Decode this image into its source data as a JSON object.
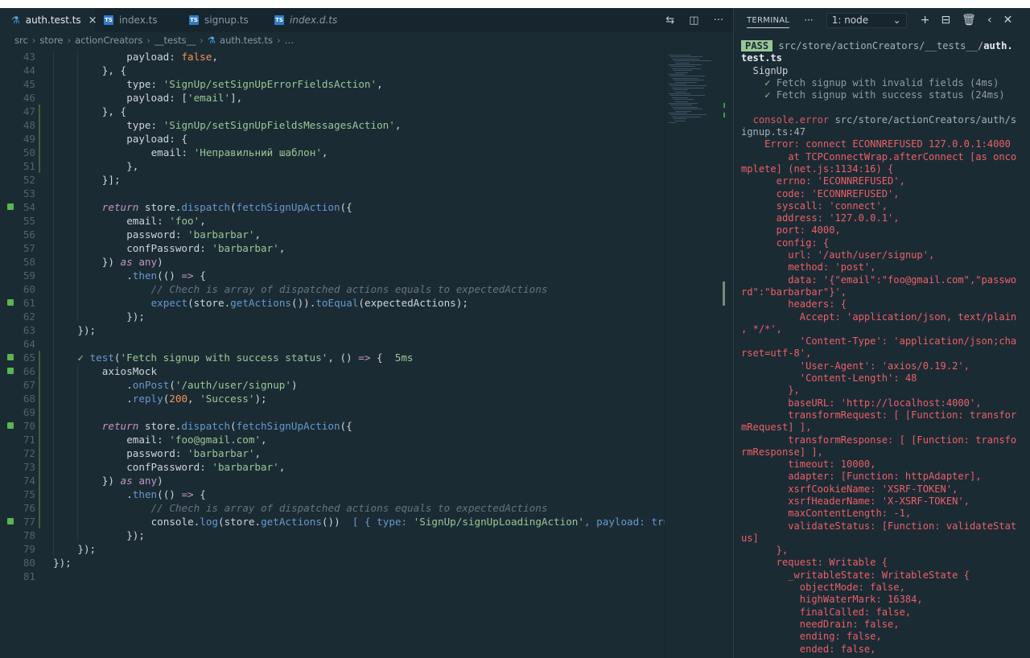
{
  "tabs": [
    {
      "label": "auth.test.ts",
      "active": true,
      "close": "×"
    },
    {
      "label": "index.ts",
      "active": false
    },
    {
      "label": "signup.ts",
      "active": false
    },
    {
      "label": "index.d.ts",
      "active": false
    }
  ],
  "breadcrumb": [
    "src",
    "store",
    "actionCreators",
    "__tests__",
    "auth.test.ts",
    "…"
  ],
  "code_lines": [
    {
      "n": "43",
      "indent": 12,
      "html": "<span class='pr'>payload</span>: <span class='b'>false</span>,"
    },
    {
      "n": "44",
      "indent": 8,
      "html": "}, {"
    },
    {
      "n": "45",
      "indent": 12,
      "html": "<span class='pr'>type</span>: <span class='s'>'SignUp/setSignUpErrorFieldsAction'</span>,"
    },
    {
      "n": "46",
      "indent": 12,
      "html": "<span class='pr'>payload</span>: [<span class='s'>'email'</span>],"
    },
    {
      "n": "47",
      "indent": 8,
      "html": "}, {"
    },
    {
      "n": "48",
      "indent": 12,
      "html": "<span class='pr'>type</span>: <span class='s'>'SignUp/setSignUpFieldsMessagesAction'</span>,"
    },
    {
      "n": "49",
      "indent": 12,
      "html": "<span class='pr'>payload</span>: {"
    },
    {
      "n": "50",
      "indent": 16,
      "html": "<span class='pr'>email</span>: <span class='s'>'Неправильний шаблон'</span>,"
    },
    {
      "n": "51",
      "indent": 12,
      "html": "},"
    },
    {
      "n": "52",
      "indent": 8,
      "html": "}];"
    },
    {
      "n": "53",
      "indent": 0,
      "html": ""
    },
    {
      "n": "54",
      "indent": 8,
      "html": "<span class='k'>return</span> store.<span class='f'>dispatch</span>(<span class='f'>fetchSignUpAction</span>({"
    },
    {
      "n": "55",
      "indent": 12,
      "html": "<span class='pr'>email</span>: <span class='s'>'foo'</span>,"
    },
    {
      "n": "56",
      "indent": 12,
      "html": "<span class='pr'>password</span>: <span class='s'>'barbarbar'</span>,"
    },
    {
      "n": "57",
      "indent": 12,
      "html": "<span class='pr'>confPassword</span>: <span class='s'>'barbarbar'</span>,"
    },
    {
      "n": "58",
      "indent": 8,
      "html": "}) <span class='k'>as</span> <span class='kw'>any</span>)"
    },
    {
      "n": "59",
      "indent": 12,
      "html": ".<span class='f'>then</span>(() <span class='kw'>=></span> {"
    },
    {
      "n": "60",
      "indent": 16,
      "html": "<span class='c'>// Chech is array of dispatched actions equals to expectedActions</span>"
    },
    {
      "n": "61",
      "indent": 16,
      "html": "<span class='f'>expect</span>(store.<span class='f'>getActions</span>()).<span class='f'>toEqual</span>(expectedActions);"
    },
    {
      "n": "62",
      "indent": 12,
      "html": "});"
    },
    {
      "n": "63",
      "indent": 4,
      "html": "});"
    },
    {
      "n": "64",
      "indent": 0,
      "html": ""
    },
    {
      "n": "65",
      "indent": 4,
      "html": "<span class='ok'>✓</span> <span class='f'>test</span>(<span class='s'>'Fetch signup with success status'</span>, () <span class='kw'>=></span> {  <span class='ok'>5ms</span>"
    },
    {
      "n": "66",
      "indent": 8,
      "html": "axiosMock"
    },
    {
      "n": "67",
      "indent": 12,
      "html": ".<span class='f'>onPost</span>(<span class='s'>'/auth/user/signup'</span>)"
    },
    {
      "n": "68",
      "indent": 12,
      "html": ".<span class='f'>reply</span>(<span class='b'>200</span>, <span class='s'>'Success'</span>);"
    },
    {
      "n": "69",
      "indent": 0,
      "html": ""
    },
    {
      "n": "70",
      "indent": 8,
      "html": "<span class='k'>return</span> store.<span class='f'>dispatch</span>(<span class='f'>fetchSignUpAction</span>({"
    },
    {
      "n": "71",
      "indent": 12,
      "html": "<span class='pr'>email</span>: <span class='s'>'foo@gmail.com'</span>,"
    },
    {
      "n": "72",
      "indent": 12,
      "html": "<span class='pr'>password</span>: <span class='s'>'barbarbar'</span>,"
    },
    {
      "n": "73",
      "indent": 12,
      "html": "<span class='pr'>confPassword</span>: <span class='s'>'barbarbar'</span>,"
    },
    {
      "n": "74",
      "indent": 8,
      "html": "}) <span class='k'>as</span> <span class='kw'>any</span>)"
    },
    {
      "n": "75",
      "indent": 12,
      "html": ".<span class='f'>then</span>(() <span class='kw'>=></span> {"
    },
    {
      "n": "76",
      "indent": 16,
      "html": "<span class='c'>// Chech is array of dispatched actions equals to expectedActions</span>"
    },
    {
      "n": "77",
      "indent": 16,
      "html": "console.<span class='f'>log</span>(store.<span class='f'>getActions</span>())  <span class='inl'>[ { type: </span><span class='s'>'SignUp/signUpLoadingAction'</span><span class='inl'>, payload: true</span>"
    },
    {
      "n": "78",
      "indent": 12,
      "html": "});"
    },
    {
      "n": "79",
      "indent": 4,
      "html": "});"
    },
    {
      "n": "80",
      "indent": 0,
      "html": "});"
    },
    {
      "n": "81",
      "indent": 0,
      "html": ""
    }
  ],
  "gutter_marks": [
    "54",
    "61",
    "65",
    "66",
    "70",
    "77"
  ],
  "terminal": {
    "title": "TERMINAL",
    "more": "···",
    "select": "1: node",
    "lines": [
      "<span class='pass'>PASS</span> <span class='dim'>src/store/actionCreators/__tests__/</span><span class='white'>auth.</span>",
      "<span class='white'>test.ts</span>",
      "  SignUp",
      "    <span class='ok'>✓</span> <span class='gray'>Fetch signup with invalid fields (4ms)</span>",
      "    <span class='ok'>✓</span> <span class='gray'>Fetch signup with success status (24ms)</span>",
      "",
      "  <span class='redd'>console.error</span> <span class='dim'>src/store/actionCreators/auth/s</span>",
      "<span class='dim'>ignup.ts:47</span>",
      "<span class='red'>    Error: connect ECONNREFUSED 127.0.0.1:4000</span>",
      "<span class='red'>        at TCPConnectWrap.afterConnect [as onco</span>",
      "<span class='red'>mplete] (net.js:1134:16) {</span>",
      "<span class='red'>      errno: 'ECONNREFUSED',</span>",
      "<span class='red'>      code: 'ECONNREFUSED',</span>",
      "<span class='red'>      syscall: 'connect',</span>",
      "<span class='red'>      address: '127.0.0.1',</span>",
      "<span class='red'>      port: 4000,</span>",
      "<span class='red'>      config: {</span>",
      "<span class='red'>        url: '/auth/user/signup',</span>",
      "<span class='red'>        method: 'post',</span>",
      "<span class='red'>        data: '{\"email\":\"foo@gmail.com\",\"passwo</span>",
      "<span class='red'>rd\":\"barbarbar\"}',</span>",
      "<span class='red'>        headers: {</span>",
      "<span class='red'>          Accept: 'application/json, text/plain</span>",
      "<span class='red'>, */*',</span>",
      "<span class='red'>          'Content-Type': 'application/json;cha</span>",
      "<span class='red'>rset=utf-8',</span>",
      "<span class='red'>          'User-Agent': 'axios/0.19.2',</span>",
      "<span class='red'>          'Content-Length': 48</span>",
      "<span class='red'>        },</span>",
      "<span class='red'>        baseURL: 'http://localhost:4000',</span>",
      "<span class='red'>        transformRequest: [ [Function: transfor</span>",
      "<span class='red'>mRequest] ],</span>",
      "<span class='red'>        transformResponse: [ [Function: transfo</span>",
      "<span class='red'>rmResponse] ],</span>",
      "<span class='red'>        timeout: 10000,</span>",
      "<span class='red'>        adapter: [Function: httpAdapter],</span>",
      "<span class='red'>        xsrfCookieName: 'XSRF-TOKEN',</span>",
      "<span class='red'>        xsrfHeaderName: 'X-XSRF-TOKEN',</span>",
      "<span class='red'>        maxContentLength: -1,</span>",
      "<span class='red'>        validateStatus: [Function: validateStat</span>",
      "<span class='red'>us]</span>",
      "<span class='red'>      },</span>",
      "<span class='red'>      request: Writable {</span>",
      "<span class='red'>        _writableState: WritableState {</span>",
      "<span class='red'>          objectMode: false,</span>",
      "<span class='red'>          highWaterMark: 16384,</span>",
      "<span class='red'>          finalCalled: false,</span>",
      "<span class='red'>          needDrain: false,</span>",
      "<span class='red'>          ending: false,</span>",
      "<span class='red'>          ended: false,</span>"
    ]
  },
  "colors": {
    "editor_bg": "#1b2b34",
    "string": "#99c794",
    "keyword": "#c594c5",
    "function": "#6699cc",
    "error": "#ec5f67",
    "pass_badge": "#99c794"
  },
  "icons": [
    "flask-icon",
    "ts-file-icon",
    "close-icon",
    "compare-changes-icon",
    "split-editor-icon",
    "plus-icon",
    "split-terminal-icon",
    "trash-icon",
    "chevron-left-icon",
    "close-panel-icon",
    "chevron-down-icon"
  ]
}
